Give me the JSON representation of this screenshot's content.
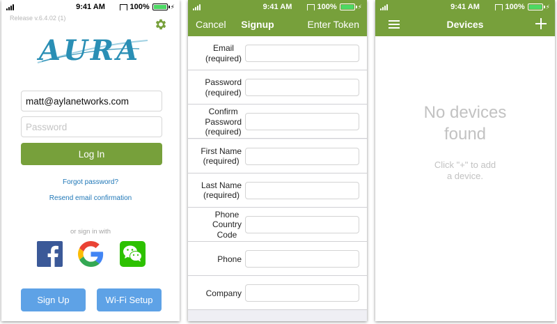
{
  "status_bar": {
    "time": "9:41 AM",
    "battery": "100%",
    "battery_level": 1.0
  },
  "login": {
    "release": "Release v.6.4.02 (1)",
    "logo_text": "AURA",
    "email_value": "matt@aylanetworks.com",
    "password_placeholder": "Password",
    "login_label": "Log In",
    "forgot_password": "Forgot password?",
    "resend_confirmation": "Resend email confirmation",
    "or_sign_in_with": "or sign in with",
    "social": [
      {
        "icon": "facebook-icon",
        "color": "#3b5998"
      },
      {
        "icon": "google-icon",
        "color": "#4285f4"
      },
      {
        "icon": "wechat-icon",
        "color": "#2dc100"
      }
    ],
    "signup_label": "Sign Up",
    "wifi_setup_label": "Wi-Fi Setup"
  },
  "signup": {
    "cancel": "Cancel",
    "title": "Signup",
    "enter_token": "Enter Token",
    "fields": [
      {
        "label": "Email\n(required)"
      },
      {
        "label": "Password\n(required)"
      },
      {
        "label": "Confirm\nPassword\n(required)"
      },
      {
        "label": "First Name\n(required)"
      },
      {
        "label": "Last Name\n(required)"
      },
      {
        "label": "Phone\nCountry\nCode"
      },
      {
        "label": "Phone"
      },
      {
        "label": "Company"
      }
    ]
  },
  "devices": {
    "title": "Devices",
    "empty_title": "No devices\nfound",
    "empty_hint": "Click \"+\" to add\na device."
  },
  "colors": {
    "accent_green": "#77a03b",
    "button_blue": "#5ea2e6",
    "link_blue": "#1f77b7"
  }
}
